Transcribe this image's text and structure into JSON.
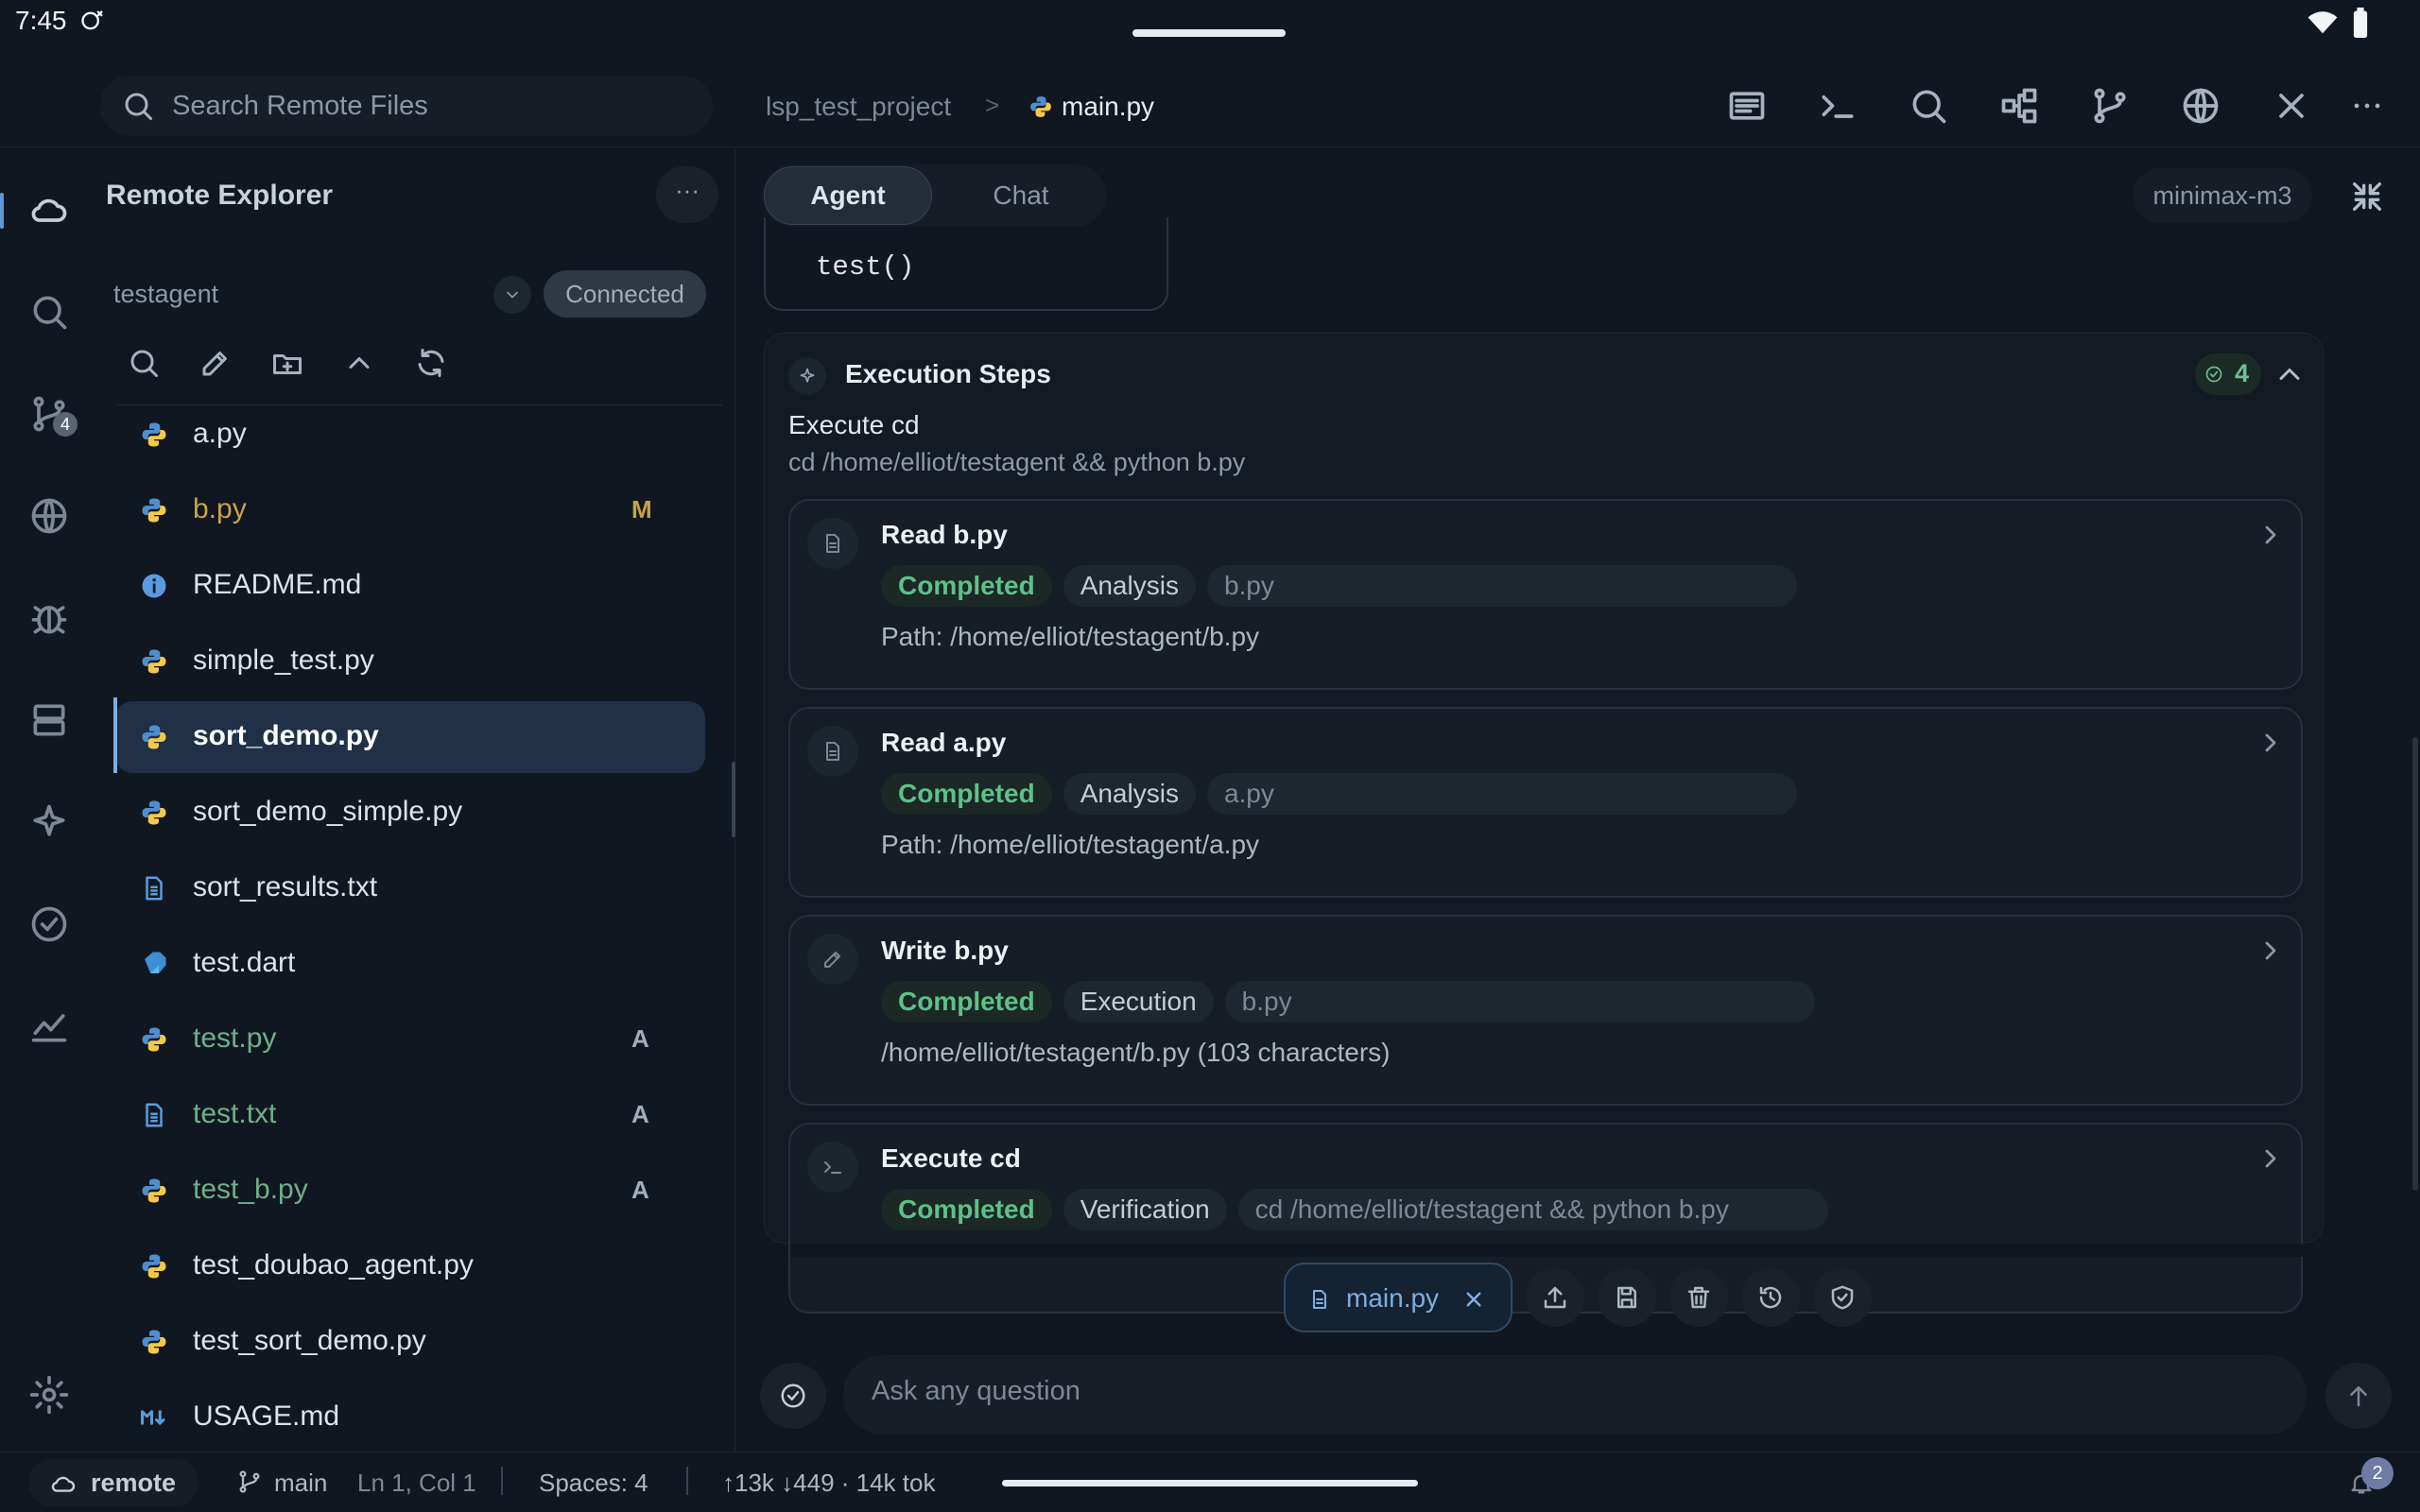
{
  "status_bar": {
    "time": "7:45"
  },
  "topbar": {
    "search_placeholder": "Search Remote Files",
    "breadcrumb_project": "lsp_test_project",
    "breadcrumb_separator": ">",
    "breadcrumb_file": "main.py",
    "actions": [
      "panel-icon",
      "terminal-icon",
      "search-icon",
      "graph-icon",
      "git-branch-icon",
      "globe-icon",
      "close-icon",
      "more-icon"
    ]
  },
  "activity_bar": {
    "items": [
      "cloud-icon",
      "search-icon",
      "source-control-icon",
      "globe-icon",
      "debug-icon",
      "server-icon",
      "sparkle-icon",
      "check-circle-icon",
      "chart-icon",
      "settings-icon"
    ],
    "scm_badge": "4"
  },
  "explorer": {
    "title": "Remote Explorer",
    "more_label": "···",
    "connection_name": "testagent",
    "connection_status": "Connected",
    "files": [
      {
        "name": "a.py",
        "status": "",
        "icon": "python-icon",
        "color": "#dce2e8"
      },
      {
        "name": "b.py",
        "status": "M",
        "icon": "python-icon",
        "color": "#c9a24a"
      },
      {
        "name": "README.md",
        "status": "",
        "icon": "info-icon",
        "color": "#dce2e8"
      },
      {
        "name": "simple_test.py",
        "status": "",
        "icon": "python-icon",
        "color": "#dce2e8"
      },
      {
        "name": "sort_demo.py",
        "status": "",
        "icon": "python-icon",
        "color": "#ffffff"
      },
      {
        "name": "sort_demo_simple.py",
        "status": "",
        "icon": "python-icon",
        "color": "#dce2e8"
      },
      {
        "name": "sort_results.txt",
        "status": "",
        "icon": "text-file-icon",
        "color": "#dce2e8"
      },
      {
        "name": "test.dart",
        "status": "",
        "icon": "dart-icon",
        "color": "#dce2e8"
      },
      {
        "name": "test.py",
        "status": "A",
        "icon": "python-icon",
        "color": "#6fb08a"
      },
      {
        "name": "test.txt",
        "status": "A",
        "icon": "text-file-icon",
        "color": "#6fb08a"
      },
      {
        "name": "test_b.py",
        "status": "A",
        "icon": "python-icon",
        "color": "#6fb08a"
      },
      {
        "name": "test_doubao_agent.py",
        "status": "",
        "icon": "python-icon",
        "color": "#dce2e8"
      },
      {
        "name": "test_sort_demo.py",
        "status": "",
        "icon": "python-icon",
        "color": "#dce2e8"
      },
      {
        "name": "USAGE.md",
        "status": "",
        "icon": "markdown-icon",
        "color": "#dce2e8"
      }
    ]
  },
  "agent_panel": {
    "tabs": [
      {
        "label": "Agent"
      },
      {
        "label": "Chat"
      }
    ],
    "model": "minimax-m3",
    "code_line": "test()",
    "steps_title": "Execution Steps",
    "steps_count": "4",
    "exec_title": "Execute cd",
    "exec_command": "cd /home/elliot/testagent && python b.py",
    "steps": [
      {
        "title": "Read b.py",
        "status": "Completed",
        "category": "Analysis",
        "target": "b.py",
        "detail": "Path: /home/elliot/testagent/b.py",
        "icon": "file-icon"
      },
      {
        "title": "Read a.py",
        "status": "Completed",
        "category": "Analysis",
        "target": "a.py",
        "detail": "Path: /home/elliot/testagent/a.py",
        "icon": "file-icon"
      },
      {
        "title": "Write b.py",
        "status": "Completed",
        "category": "Execution",
        "target": "b.py",
        "detail": "/home/elliot/testagent/b.py (103 characters)",
        "icon": "pencil-icon"
      },
      {
        "title": "Execute cd",
        "status": "Completed",
        "category": "Verification",
        "target": "cd /home/elliot/testagent && python b.py",
        "detail": "",
        "icon": "terminal-icon"
      }
    ],
    "attachment": "main.py",
    "attachment_actions": [
      "upload-icon",
      "save-icon",
      "trash-icon",
      "history-icon",
      "shield-check-icon"
    ],
    "input_placeholder": "Ask any question"
  },
  "bottom_status": {
    "remote": "remote",
    "branch": "main",
    "cursor": "Ln 1, Col 1",
    "spaces": "Spaces: 4",
    "tokens": "↑13k ↓449 · 14k tok",
    "notifications": "2"
  }
}
